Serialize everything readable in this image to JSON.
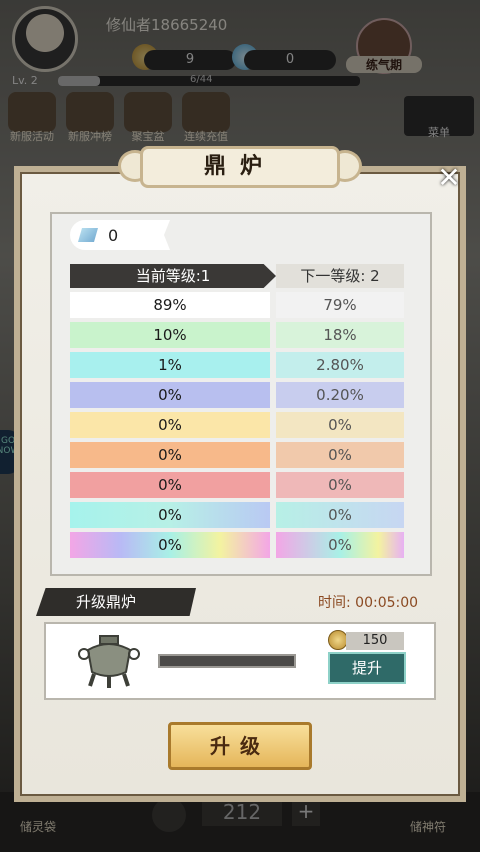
{
  "player": {
    "name": "修仙者18665240",
    "level_text": "Lv. 2",
    "xp_text": "6/44",
    "xp_progress": 0.14
  },
  "resources": [
    {
      "name": "coin",
      "value": "9"
    },
    {
      "name": "gem",
      "value": "0"
    }
  ],
  "xian_badge": "练气期",
  "top_menu": [
    {
      "label": "新服活动",
      "icon": "event-icon"
    },
    {
      "label": "新服冲榜",
      "icon": "ranking-icon"
    },
    {
      "label": "聚宝盆",
      "icon": "treasure-icon"
    },
    {
      "label": "连续充值",
      "icon": "recharge-icon"
    }
  ],
  "menu_label": "菜单",
  "side_badge": "GO NOW",
  "bottom": {
    "left_label": "储灵袋",
    "right_label": "储神符",
    "count": "212",
    "plus": "+"
  },
  "dialog": {
    "title": "鼎炉",
    "close": "✕",
    "gem_count": "0",
    "header_current": "当前等级:1",
    "header_next": "下一等级: 2",
    "rows": [
      {
        "current": "89%",
        "next": "79%",
        "tier": "white"
      },
      {
        "current": "10%",
        "next": "18%",
        "tier": "green"
      },
      {
        "current": "1%",
        "next": "2.80%",
        "tier": "cyan"
      },
      {
        "current": "0%",
        "next": "0.20%",
        "tier": "blue"
      },
      {
        "current": "0%",
        "next": "0%",
        "tier": "yellow"
      },
      {
        "current": "0%",
        "next": "0%",
        "tier": "orange"
      },
      {
        "current": "0%",
        "next": "0%",
        "tier": "red"
      },
      {
        "current": "0%",
        "next": "0%",
        "tier": "cyan-gradient"
      },
      {
        "current": "0%",
        "next": "0%",
        "tier": "rainbow"
      }
    ],
    "upgrade_section_label": "升级鼎炉",
    "timer_text": "时间: 00:05:00",
    "coin_cost": "150",
    "boost_button": "提升",
    "upgrade_button": "升级"
  },
  "colors": {
    "white": "#ffffff",
    "green": "#c9f3cc",
    "cyan": "#a8f0ee",
    "blue": "#b8bfef",
    "yellow": "#fbe6a8",
    "orange": "#f7b98a",
    "red": "#f1a0a0"
  }
}
